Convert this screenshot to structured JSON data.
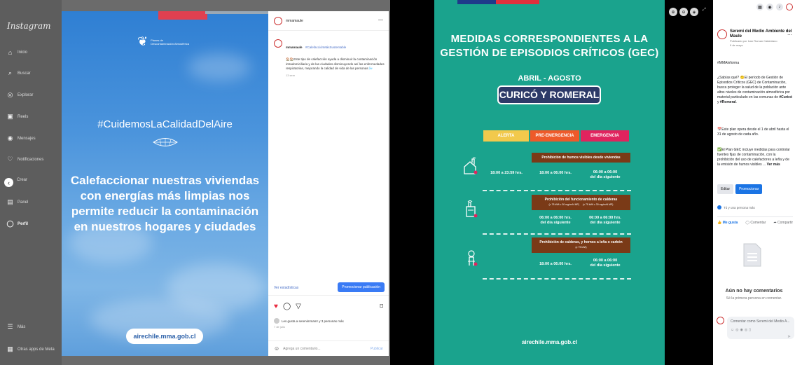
{
  "instagram": {
    "logo": "Instagram",
    "nav": [
      {
        "label": "Inicio",
        "icon": "home-icon"
      },
      {
        "label": "Buscar",
        "icon": "search-icon"
      },
      {
        "label": "Explorar",
        "icon": "compass-icon"
      },
      {
        "label": "Reels",
        "icon": "reels-icon"
      },
      {
        "label": "Mensajes",
        "icon": "messenger-icon"
      },
      {
        "label": "Notificaciones",
        "icon": "heart-icon"
      },
      {
        "label": "Crear",
        "icon": "plus-icon"
      },
      {
        "label": "Panel",
        "icon": "chart-icon"
      },
      {
        "label": "Perfil",
        "icon": "profile-icon"
      }
    ],
    "more": "Más",
    "meta_apps": "Otras apps de Meta",
    "media": {
      "logo_line1": "Planes de",
      "logo_line2": "Descontaminación Atmosférica",
      "hashtag": "#CuidemosLaCalidadDelAire",
      "headline": "Calefaccionar nuestras viviendas con energías más limpias nos permite reducir la contaminación en nuestros hogares y ciudades",
      "url": "airechile.mma.gob.cl"
    },
    "panel": {
      "username": "mmamaule",
      "caption_user": "mmamaule",
      "caption_tag": "#CalefacciónMásSustentable",
      "caption_body": "🏠🏠Este tipo de calefacción ayuda a disminuir la contaminación intradomiciliaria y de las ciudades disminuyendo así las enfermedades respiratorias, mejorando la calidad de vida de las personas 🌬️",
      "caption_time": "13 sem",
      "stats_link": "Ver estadísticas",
      "promote": "Promocionar publicación",
      "likes": "Les gusta a serenimmamr y 3 personas más",
      "date": "7 de julio",
      "comment_placeholder": "Agrega un comentario...",
      "publish": "Publicar"
    }
  },
  "facebook": {
    "poster": {
      "title_line1": "MEDIDAS CORRESPONDIENTES A LA",
      "title_line2": "GESTIÓN DE EPISODIOS CRÍTICOS (GEC)",
      "period": "ABRIL - AGOSTO",
      "location": "CURICÓ Y ROMERAL",
      "levels": [
        "ALERTA",
        "PRE-EMERGENCIA",
        "EMERGENCIA"
      ],
      "row1": {
        "bar": "Prohibición de humos visibles desde viviendas",
        "alerta": "18:00 a 23:59 hrs.",
        "pre": "18:00 a 06:00 hrs.",
        "emer_1": "06:00 a 06:00",
        "emer_2": "del día siguiente"
      },
      "row2": {
        "bar": "Prohibición del funcionamiento de calderas",
        "sub_a": "(≥ 75 kWt ≥ 30 mg/m³N MP)",
        "sub_b": "(≥ 75 kWt ≥ 30 mg/m³N MP)",
        "pre_1": "06:00 a 06:00 hrs.",
        "pre_2": "del día siguiente",
        "emer_1": "06:00 a 06:00 hrs.",
        "emer_2": "del día siguiente"
      },
      "row3": {
        "bar": "Prohibición de calderas, y hornos a leña o carbón",
        "sub": "(≥ 75 kWt)",
        "pre": "18:00 a 06:00 hrs.",
        "emer_1": "06:00 a 06:00",
        "emer_2": "del día siguiente"
      },
      "url": "airechile.mma.gob.cl"
    },
    "post": {
      "author": "Seremi del Medio Ambiente del Maule",
      "meta_1": "Publicado por Ivan Roman Calabriano",
      "meta_2": "9 de mayo",
      "hashtag": "#MMAinforma",
      "para1_a": "¿Sabías qué? 🙂El período de Gestión de Episodios Críticos (GEC) de Contaminación, busca proteger la salud de la población ante altos niveles de contaminación atmosférica por material particulado en las comunas de ",
      "para1_b": "#Curicó",
      "para1_c": " y ",
      "para1_d": "#Romeral",
      "para1_e": ".",
      "para2": "📅Este plan opera desde el 1 de abril hasta el 31 de agosto de cada año.",
      "para3": "✅El Plan GEC incluye medidas para controlar fuentes fijas de contaminación, con la prohibición del uso de calefactores a leña y de la emisión de humos visibles ...",
      "see_more": "Ver más",
      "edit": "Editar",
      "promote": "Promocionar",
      "reactions": "Tú y una persona más",
      "like": "Me gusta",
      "comment": "Comentar",
      "share": "Compartir",
      "no_comments": "Aún no hay comentarios",
      "be_first": "Sé la primera persona en comentar.",
      "comment_placeholder": "Comentar como Seremi del Medio A..."
    }
  }
}
